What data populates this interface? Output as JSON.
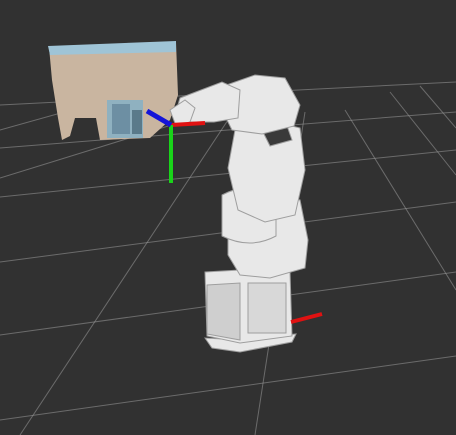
{
  "viewer": {
    "background_color": "#313131",
    "grid_color": "#9a9a9a",
    "robot_color": "#e8e8e8",
    "robot_shadow_color": "#9e9e9e"
  },
  "axes": {
    "x_color": "#e01212",
    "y_color": "#19d419",
    "z_color": "#1414d8"
  },
  "pointcloud": {
    "wall_color": "#c9b5a0",
    "top_color": "#9fc4d6",
    "opening_color": "#8fb1c0"
  },
  "icons": [
    "robot-arm-model",
    "tf-frame-axes",
    "point-cloud",
    "ground-grid"
  ]
}
